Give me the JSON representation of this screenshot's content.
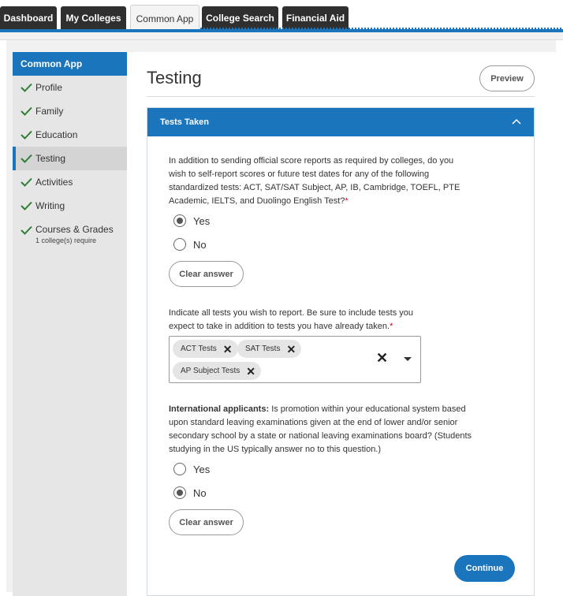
{
  "top_tabs": [
    {
      "label": "Dashboard"
    },
    {
      "label": "My Colleges"
    },
    {
      "label": "Common App"
    },
    {
      "label": "College Search"
    },
    {
      "label": "Financial Aid"
    }
  ],
  "sidebar": {
    "header": "Common App",
    "items": [
      {
        "label": "Profile",
        "icon": "check-icon"
      },
      {
        "label": "Family",
        "icon": "check-icon"
      },
      {
        "label": "Education",
        "icon": "check-icon"
      },
      {
        "label": "Testing",
        "icon": "check-icon",
        "active": true
      },
      {
        "label": "Activities",
        "icon": "check-icon"
      },
      {
        "label": "Writing",
        "icon": "check-icon"
      },
      {
        "label": "Courses & Grades",
        "sub": "1 college(s) require",
        "icon": "check-icon"
      }
    ]
  },
  "main": {
    "title": "Testing",
    "preview_label": "Preview",
    "section": {
      "title": "Tests Taken",
      "q1": {
        "text": "In addition to sending official score reports as required by colleges, do you wish to self-report scores or future test dates for any of the following standardized tests: ACT, SAT/SAT Subject, AP, IB, Cambridge, TOEFL, PTE Academic, IELTS, and Duolingo English Test?",
        "required_mark": "*",
        "options": [
          "Yes",
          "No"
        ],
        "selected": "Yes",
        "clear_label": "Clear answer"
      },
      "q2": {
        "text": "Indicate all tests you wish to report. Be sure to include tests you expect to take in addition to tests you have already taken.",
        "required_mark": "*",
        "chips": [
          "ACT Tests",
          "SAT Tests",
          "AP Subject Tests"
        ]
      },
      "q3": {
        "bold_prefix": "International applicants:",
        "text": " Is promotion within your educational system based upon standard leaving examinations given at the end of lower and/or senior secondary school by a state or national leaving examinations board? (Students studying in the US typically answer no to this question.)",
        "options": [
          "Yes",
          "No"
        ],
        "selected": "No",
        "clear_label": "Clear answer"
      },
      "continue_label": "Continue"
    }
  },
  "colors": {
    "accent": "#1b75bc",
    "tab_dark": "#2f2f2f",
    "check": "#2e7d32",
    "required": "#d0021b"
  }
}
